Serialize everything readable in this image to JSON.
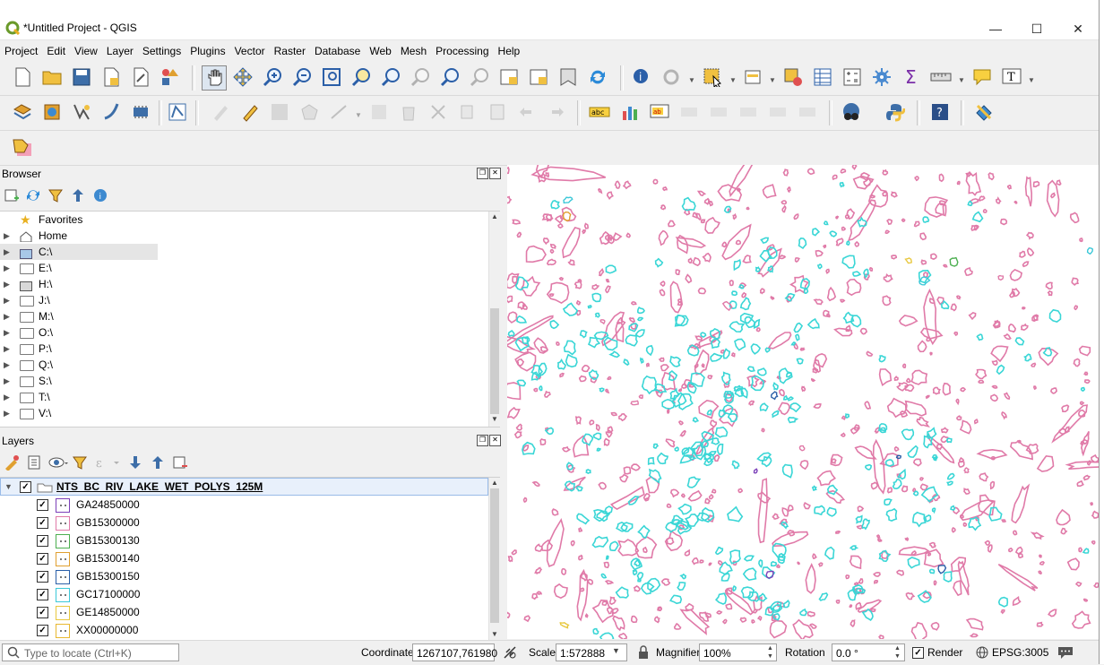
{
  "window": {
    "title": "*Untitled Project - QGIS",
    "minimize": "—",
    "maximize": "☐",
    "close": "✕"
  },
  "menu": [
    "Project",
    "Edit",
    "View",
    "Layer",
    "Settings",
    "Plugins",
    "Vector",
    "Raster",
    "Database",
    "Web",
    "Mesh",
    "Processing",
    "Help"
  ],
  "browser": {
    "title": "Browser",
    "items": [
      {
        "label": "Favorites",
        "icon": "star-icon"
      },
      {
        "label": "Home",
        "icon": "home-icon"
      },
      {
        "label": "C:\\",
        "icon": "drive-icon"
      },
      {
        "label": "E:\\",
        "icon": "folder-icon"
      },
      {
        "label": "H:\\",
        "icon": "drive-icon"
      },
      {
        "label": "J:\\",
        "icon": "folder-icon"
      },
      {
        "label": "M:\\",
        "icon": "folder-icon"
      },
      {
        "label": "O:\\",
        "icon": "folder-icon"
      },
      {
        "label": "P:\\",
        "icon": "folder-icon"
      },
      {
        "label": "Q:\\",
        "icon": "folder-icon"
      },
      {
        "label": "S:\\",
        "icon": "folder-icon"
      },
      {
        "label": "T:\\",
        "icon": "folder-icon"
      },
      {
        "label": "V:\\",
        "icon": "folder-icon"
      }
    ]
  },
  "layers": {
    "title": "Layers",
    "group": "NTS_BC_RIV_LAKE_WET_POLYS_125M",
    "items": [
      {
        "label": "GA24850000",
        "color": "#7b3fb8"
      },
      {
        "label": "GB15300000",
        "color": "#e07aa8"
      },
      {
        "label": "GB15300130",
        "color": "#4caf50"
      },
      {
        "label": "GB15300140",
        "color": "#e0a030"
      },
      {
        "label": "GB15300150",
        "color": "#2b5fa8"
      },
      {
        "label": "GC17100000",
        "color": "#3cc8d8"
      },
      {
        "label": "GE14850000",
        "color": "#e8c840"
      },
      {
        "label": "XX00000000",
        "color": "#e8b830"
      }
    ]
  },
  "map": {
    "primary_color": "#e07aa8",
    "secondary_color": "#3ad6d6"
  },
  "status": {
    "locate_placeholder": "Type to locate (Ctrl+K)",
    "coordinate_label": "Coordinate",
    "coordinate_value": "1267107,761980",
    "scale_label": "Scale",
    "scale_value": "1:572888",
    "magnifier_label": "Magnifier",
    "magnifier_value": "100%",
    "rotation_label": "Rotation",
    "rotation_value": "0.0 °",
    "render_label": "Render",
    "crs": "EPSG:3005"
  }
}
